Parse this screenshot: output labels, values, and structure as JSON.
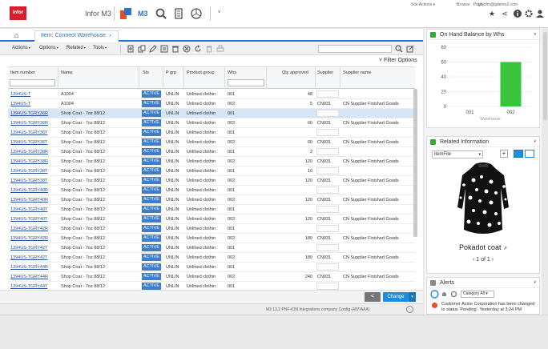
{
  "header": {
    "logo": "infor",
    "app_title": "Infor M3",
    "m3_label": "M3",
    "site_actions": "Site Actions ▾",
    "links": [
      "Browse",
      "Page"
    ],
    "user": "ghjohn@gdemo2.com"
  },
  "tab": {
    "label": "Item. Connect Warehouse"
  },
  "toolbar": {
    "menus": [
      "Actions",
      "Options",
      "Related",
      "Tools"
    ]
  },
  "filter_options": "Filter Options",
  "grid": {
    "columns": [
      "Item number",
      "Name",
      "Sts",
      "P grp",
      "Product group",
      "Whs",
      "Qty approved",
      "Supplier",
      "Supplier name"
    ],
    "rows": [
      {
        "item": "1394US-T",
        "name": "A1004",
        "sts": "ACTIVE",
        "pgrp": "UNLIN",
        "pgroup": "Unlined clothin",
        "whs": "001",
        "qty": "48",
        "supplier": "",
        "sname": ""
      },
      {
        "item": "1394US-T",
        "name": "A1004",
        "sts": "ACTIVE",
        "pgrp": "UNLIN",
        "pgroup": "Unlined clothin",
        "whs": "002",
        "qty": "5",
        "supplier": "CN031",
        "sname": "CN Supplier Finished Goods"
      },
      {
        "item": "1394US-TGRY36R",
        "name": "Shop Coat - 7oz 88/12",
        "sts": "ACTIVE",
        "pgrp": "UNLIN",
        "pgroup": "Unlined clothin",
        "whs": "001",
        "qty": "",
        "supplier": "",
        "sname": "",
        "selected": true
      },
      {
        "item": "1394US-TGRY36R",
        "name": "Shop Coat - 7oz 88/12",
        "sts": "ACTIVE",
        "pgrp": "UNLIN",
        "pgroup": "Unlined clothin",
        "whs": "002",
        "qty": "60",
        "supplier": "CN031",
        "sname": "CN Supplier Finished Goods"
      },
      {
        "item": "1394US-TGRY36T",
        "name": "Shop Coat - 7oz 88/12",
        "sts": "ACTIVE",
        "pgrp": "UNLIN",
        "pgroup": "Unlined clothin",
        "whs": "001",
        "qty": "",
        "supplier": "",
        "sname": ""
      },
      {
        "item": "1394US-TGRY36T",
        "name": "Shop Coat - 7oz 88/12",
        "sts": "ACTIVE",
        "pgrp": "UNLIN",
        "pgroup": "Unlined clothin",
        "whs": "002",
        "qty": "60",
        "supplier": "CN031",
        "sname": "CN Supplier Finished Goods"
      },
      {
        "item": "1394US-TGRY38R",
        "name": "Shop Coat - 7oz 88/12",
        "sts": "ACTIVE",
        "pgrp": "UNLIN",
        "pgroup": "Unlined clothin",
        "whs": "001",
        "qty": "2",
        "supplier": "",
        "sname": ""
      },
      {
        "item": "1394US-TGRY38R",
        "name": "Shop Coat - 7oz 88/12",
        "sts": "ACTIVE",
        "pgrp": "UNLIN",
        "pgroup": "Unlined clothin",
        "whs": "002",
        "qty": "120",
        "supplier": "CN031",
        "sname": "CN Supplier Finished Goods"
      },
      {
        "item": "1394US-TGRY38T",
        "name": "Shop Coat - 7oz 88/12",
        "sts": "ACTIVE",
        "pgrp": "UNLIN",
        "pgroup": "Unlined clothin",
        "whs": "001",
        "qty": "10",
        "supplier": "",
        "sname": ""
      },
      {
        "item": "1394US-TGRY38T",
        "name": "Shop Coat - 7oz 88/12",
        "sts": "ACTIVE",
        "pgrp": "UNLIN",
        "pgroup": "Unlined clothin",
        "whs": "002",
        "qty": "120",
        "supplier": "CN031",
        "sname": "CN Supplier Finished Goods"
      },
      {
        "item": "1394US-TGRY40R",
        "name": "Shop Coat - 7oz 88/12",
        "sts": "ACTIVE",
        "pgrp": "UNLIN",
        "pgroup": "Unlined clothin",
        "whs": "001",
        "qty": "",
        "supplier": "",
        "sname": ""
      },
      {
        "item": "1394US-TGRY40R",
        "name": "Shop Coat - 7oz 88/12",
        "sts": "ACTIVE",
        "pgrp": "UNLIN",
        "pgroup": "Unlined clothin",
        "whs": "002",
        "qty": "120",
        "supplier": "CN031",
        "sname": "CN Supplier Finished Goods"
      },
      {
        "item": "1394US-TGRY40T",
        "name": "Shop Coat - 7oz 88/12",
        "sts": "ACTIVE",
        "pgrp": "UNLIN",
        "pgroup": "Unlined clothin",
        "whs": "001",
        "qty": "",
        "supplier": "",
        "sname": ""
      },
      {
        "item": "1394US-TGRY40T",
        "name": "Shop Coat - 7oz 88/12",
        "sts": "ACTIVE",
        "pgrp": "UNLIN",
        "pgroup": "Unlined clothin",
        "whs": "002",
        "qty": "120",
        "supplier": "CN031",
        "sname": "CN Supplier Finished Goods"
      },
      {
        "item": "1394US-TGRY42R",
        "name": "Shop Coat - 7oz 88/12",
        "sts": "ACTIVE",
        "pgrp": "UNLIN",
        "pgroup": "Unlined clothin",
        "whs": "001",
        "qty": "",
        "supplier": "",
        "sname": ""
      },
      {
        "item": "1394US-TGRY42R",
        "name": "Shop Coat - 7oz 88/12",
        "sts": "ACTIVE",
        "pgrp": "UNLIN",
        "pgroup": "Unlined clothin",
        "whs": "002",
        "qty": "180",
        "supplier": "CN031",
        "sname": "CN Supplier Finished Goods"
      },
      {
        "item": "1394US-TGRY42T",
        "name": "Shop Coat - 7oz 88/12",
        "sts": "ACTIVE",
        "pgrp": "UNLIN",
        "pgroup": "Unlined clothin",
        "whs": "001",
        "qty": "",
        "supplier": "",
        "sname": ""
      },
      {
        "item": "1394US-TGRY42T",
        "name": "Shop Coat - 7oz 88/12",
        "sts": "ACTIVE",
        "pgrp": "UNLIN",
        "pgroup": "Unlined clothin",
        "whs": "002",
        "qty": "180",
        "supplier": "CN031",
        "sname": "CN Supplier Finished Goods"
      },
      {
        "item": "1394US-TGRY44R",
        "name": "Shop Coat - 7oz 88/12",
        "sts": "ACTIVE",
        "pgrp": "UNLIN",
        "pgroup": "Unlined clothin",
        "whs": "001",
        "qty": "",
        "supplier": "",
        "sname": ""
      },
      {
        "item": "1394US-TGRY44R",
        "name": "Shop Coat - 7oz 88/12",
        "sts": "ACTIVE",
        "pgrp": "UNLIN",
        "pgroup": "Unlined clothin",
        "whs": "002",
        "qty": "240",
        "supplier": "CN031",
        "sname": "CN Supplier Finished Goods"
      },
      {
        "item": "1394US-TGRY44T",
        "name": "Shop Coat - 7oz 88/12",
        "sts": "ACTIVE",
        "pgrp": "UNLIN",
        "pgroup": "Unlined clothin",
        "whs": "001",
        "qty": "",
        "supplier": "",
        "sname": ""
      }
    ]
  },
  "buttons": {
    "change": "Change",
    "back": "<"
  },
  "status_bar": "M3 13.2 PNF-ION Integrations company Config (407/AAA)",
  "on_hand": {
    "title": "On Hand Balance by Whs",
    "chart_data": {
      "type": "bar",
      "categories": [
        "001",
        "002"
      ],
      "values": [
        0,
        60
      ],
      "xlabel": "Warehouse",
      "ylabel": "",
      "ylim": [
        0,
        80
      ],
      "yticks": [
        0,
        20,
        40,
        60,
        80
      ],
      "color": "#39c43c"
    }
  },
  "related": {
    "title": "Related Information",
    "select_value": "itemFile",
    "image_title": "Pokadot coat",
    "pager": "1 of 1"
  },
  "alerts": {
    "title": "Alerts",
    "category": "Category All",
    "text": "Customer Acme Corporation has been changed to status 'Pending'. Yesterday at 3:24 PM"
  }
}
